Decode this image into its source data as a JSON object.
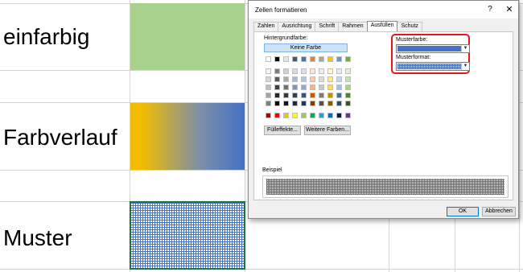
{
  "sheet": {
    "rows": [
      {
        "label": "einfarbig"
      },
      {
        "label": "Farbverlauf"
      },
      {
        "label": "Muster"
      }
    ]
  },
  "dialog": {
    "title": "Zellen formatieren",
    "help_glyph": "?",
    "close_glyph": "✕",
    "tabs": [
      "Zahlen",
      "Ausrichtung",
      "Schrift",
      "Rahmen",
      "Ausfüllen",
      "Schutz"
    ],
    "active_tab": "Ausfüllen",
    "background_color_label": "Hintergrundfarbe:",
    "no_color_button": "Keine Farbe",
    "fill_effects_button": "Fülleffekte...",
    "more_colors_button": "Weitere Farben...",
    "pattern_color_label": "Musterfarbe:",
    "pattern_color_value": "#4472c4",
    "pattern_style_label": "Musterformat:",
    "sample_label": "Beispiel",
    "ok_button": "OK",
    "cancel_button": "Abbrechen",
    "theme_colors": [
      "#ffffff",
      "#000000",
      "#e7e6e6",
      "#44546a",
      "#4472c4",
      "#ed7d31",
      "#a5a5a5",
      "#ffc000",
      "#5b9bd5",
      "#70ad47"
    ],
    "theme_tints": [
      [
        "#f2f2f2",
        "#7f7f7f",
        "#d0cece",
        "#d6dce4",
        "#d9e2f3",
        "#fbe5d5",
        "#ededed",
        "#fff2cc",
        "#deebf6",
        "#e2efd9"
      ],
      [
        "#d8d8d8",
        "#595959",
        "#aeabab",
        "#adb9ca",
        "#b4c6e7",
        "#f7cbac",
        "#dbdbdb",
        "#ffe599",
        "#bdd7ee",
        "#c5e0b3"
      ],
      [
        "#bfbfbf",
        "#3f3f3f",
        "#757070",
        "#8496b0",
        "#8eaadb",
        "#f4b183",
        "#c9c9c9",
        "#ffd966",
        "#9cc3e5",
        "#a8d08d"
      ],
      [
        "#a5a5a5",
        "#262626",
        "#3a3838",
        "#323f4f",
        "#2f5496",
        "#c55a11",
        "#7b7b7b",
        "#bf9000",
        "#2e75b5",
        "#538135"
      ],
      [
        "#7f7f7f",
        "#0c0c0c",
        "#171616",
        "#222a35",
        "#1f3864",
        "#833c0b",
        "#525252",
        "#7f6000",
        "#1e4e79",
        "#375623"
      ]
    ],
    "standard_colors": [
      "#c00000",
      "#ff0000",
      "#ffc000",
      "#ffff00",
      "#92d050",
      "#00b050",
      "#00b0f0",
      "#0070c0",
      "#002060",
      "#7030a0"
    ],
    "highlight_color": "#e0181e"
  }
}
